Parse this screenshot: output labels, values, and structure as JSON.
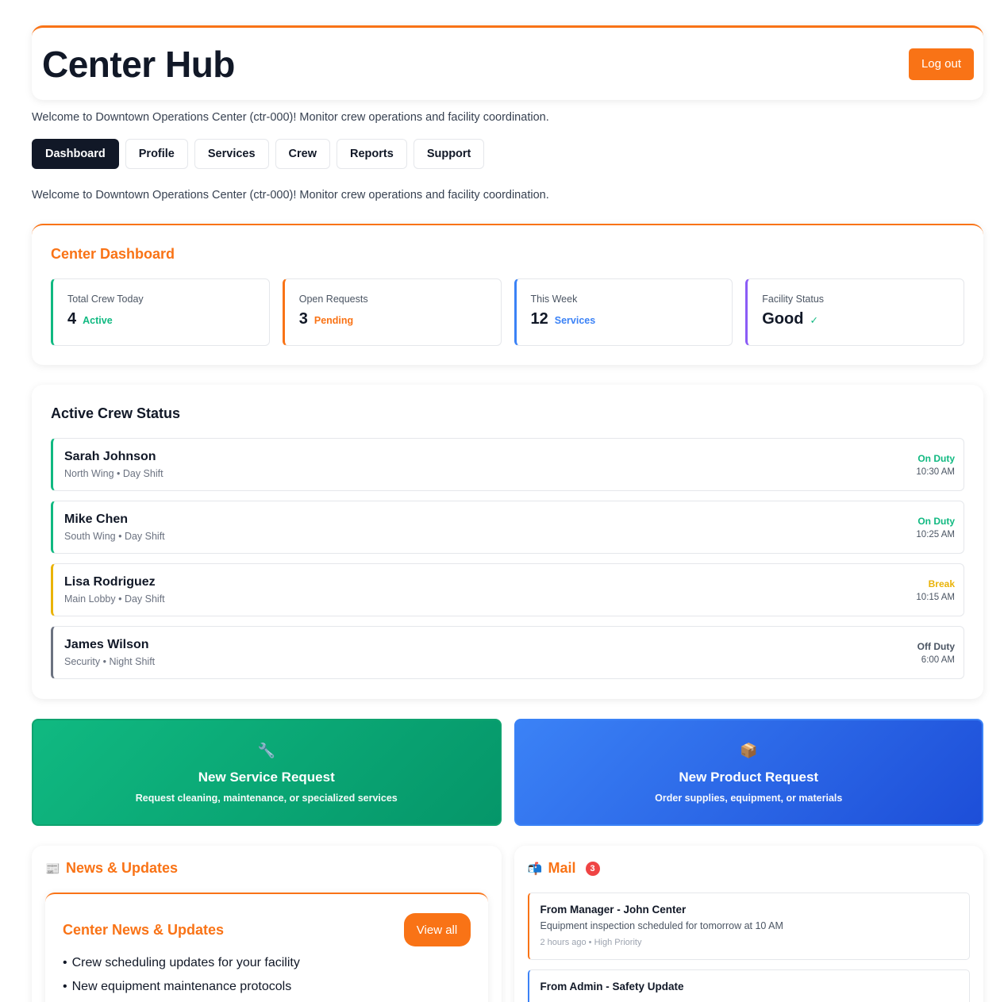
{
  "header": {
    "title": "Center Hub",
    "logout_label": "Log out"
  },
  "welcome_text": "Welcome to Downtown Operations Center (ctr-000)! Monitor crew operations and facility coordination.",
  "tabs": [
    {
      "label": "Dashboard",
      "active": true
    },
    {
      "label": "Profile",
      "active": false
    },
    {
      "label": "Services",
      "active": false
    },
    {
      "label": "Crew",
      "active": false
    },
    {
      "label": "Reports",
      "active": false
    },
    {
      "label": "Support",
      "active": false
    }
  ],
  "dashboard": {
    "title": "Center Dashboard",
    "stats": [
      {
        "label": "Total Crew Today",
        "value": "4",
        "sub": "Active",
        "color": "#10b981"
      },
      {
        "label": "Open Requests",
        "value": "3",
        "sub": "Pending",
        "color": "#f97316"
      },
      {
        "label": "This Week",
        "value": "12",
        "sub": "Services",
        "color": "#3b82f6"
      },
      {
        "label": "Facility Status",
        "value": "Good",
        "sub": "✓",
        "color": "#8b5cf6"
      }
    ]
  },
  "crew": {
    "title": "Active Crew Status",
    "members": [
      {
        "name": "Sarah Johnson",
        "location": "North Wing • Day Shift",
        "status": "On Duty",
        "time": "10:30 AM",
        "color": "#10b981"
      },
      {
        "name": "Mike Chen",
        "location": "South Wing • Day Shift",
        "status": "On Duty",
        "time": "10:25 AM",
        "color": "#10b981"
      },
      {
        "name": "Lisa Rodriguez",
        "location": "Main Lobby • Day Shift",
        "status": "Break",
        "time": "10:15 AM",
        "color": "#eab308"
      },
      {
        "name": "James Wilson",
        "location": "Security • Night Shift",
        "status": "Off Duty",
        "time": "6:00 AM",
        "color": "#6b7280"
      }
    ]
  },
  "actions": {
    "service": {
      "icon": "wrench-icon",
      "glyph": "🔧",
      "title": "New Service Request",
      "desc": "Request cleaning, maintenance, or specialized services"
    },
    "product": {
      "icon": "package-icon",
      "glyph": "📦",
      "title": "New Product Request",
      "desc": "Order supplies, equipment, or materials"
    }
  },
  "news": {
    "icon": "newspaper-icon",
    "glyph": "📰",
    "title": "News & Updates",
    "inner_title": "Center News & Updates",
    "view_all_label": "View all",
    "items": [
      "Crew scheduling updates for your facility",
      "New equipment maintenance protocols"
    ]
  },
  "mail": {
    "icon": "mailbox-icon",
    "glyph": "📬",
    "title": "Mail",
    "count": "3",
    "messages": [
      {
        "from": "From Manager - John Center",
        "text": "Equipment inspection scheduled for tomorrow at 10 AM",
        "meta": "2 hours ago • High Priority"
      },
      {
        "from": "From Admin - Safety Update",
        "text": "",
        "meta": ""
      }
    ]
  }
}
